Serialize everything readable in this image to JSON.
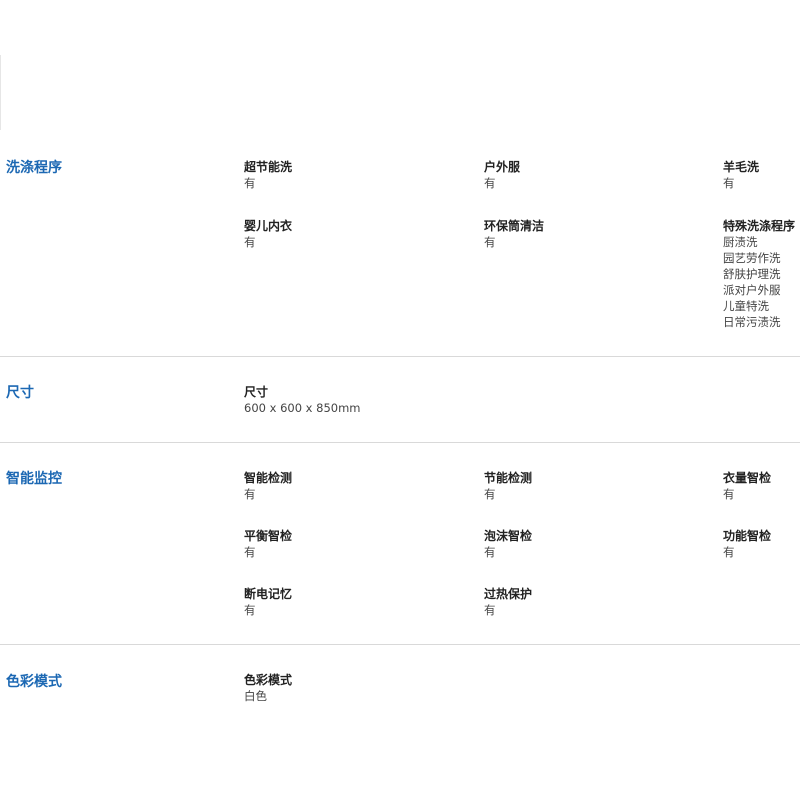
{
  "sections": {
    "wash_programs": {
      "title": "洗涤程序",
      "items": [
        {
          "label": "超节能洗",
          "value": "有"
        },
        {
          "label": "户外服",
          "value": "有"
        },
        {
          "label": "羊毛洗",
          "value": "有"
        },
        {
          "label": "婴儿内衣",
          "value": "有"
        },
        {
          "label": "环保筒清洁",
          "value": "有"
        },
        {
          "label": "特殊洗涤程序",
          "values": [
            "厨渍洗",
            "园艺劳作洗",
            "舒肤护理洗",
            "派对户外服",
            "儿童特洗",
            "日常污渍洗"
          ]
        }
      ]
    },
    "dimensions": {
      "title": "尺寸",
      "items": [
        {
          "label": "尺寸",
          "value": "600 x 600 x 850mm"
        }
      ]
    },
    "smart_monitoring": {
      "title": "智能监控",
      "items": [
        {
          "label": "智能检测",
          "value": "有"
        },
        {
          "label": "节能检测",
          "value": "有"
        },
        {
          "label": "衣量智检",
          "value": "有"
        },
        {
          "label": "平衡智检",
          "value": "有"
        },
        {
          "label": "泡沫智检",
          "value": "有"
        },
        {
          "label": "功能智检",
          "value": "有"
        },
        {
          "label": "断电记忆",
          "value": "有"
        },
        {
          "label": "过热保护",
          "value": "有"
        }
      ]
    },
    "color_mode": {
      "title": "色彩模式",
      "items": [
        {
          "label": "色彩模式",
          "value": "白色"
        }
      ]
    }
  }
}
